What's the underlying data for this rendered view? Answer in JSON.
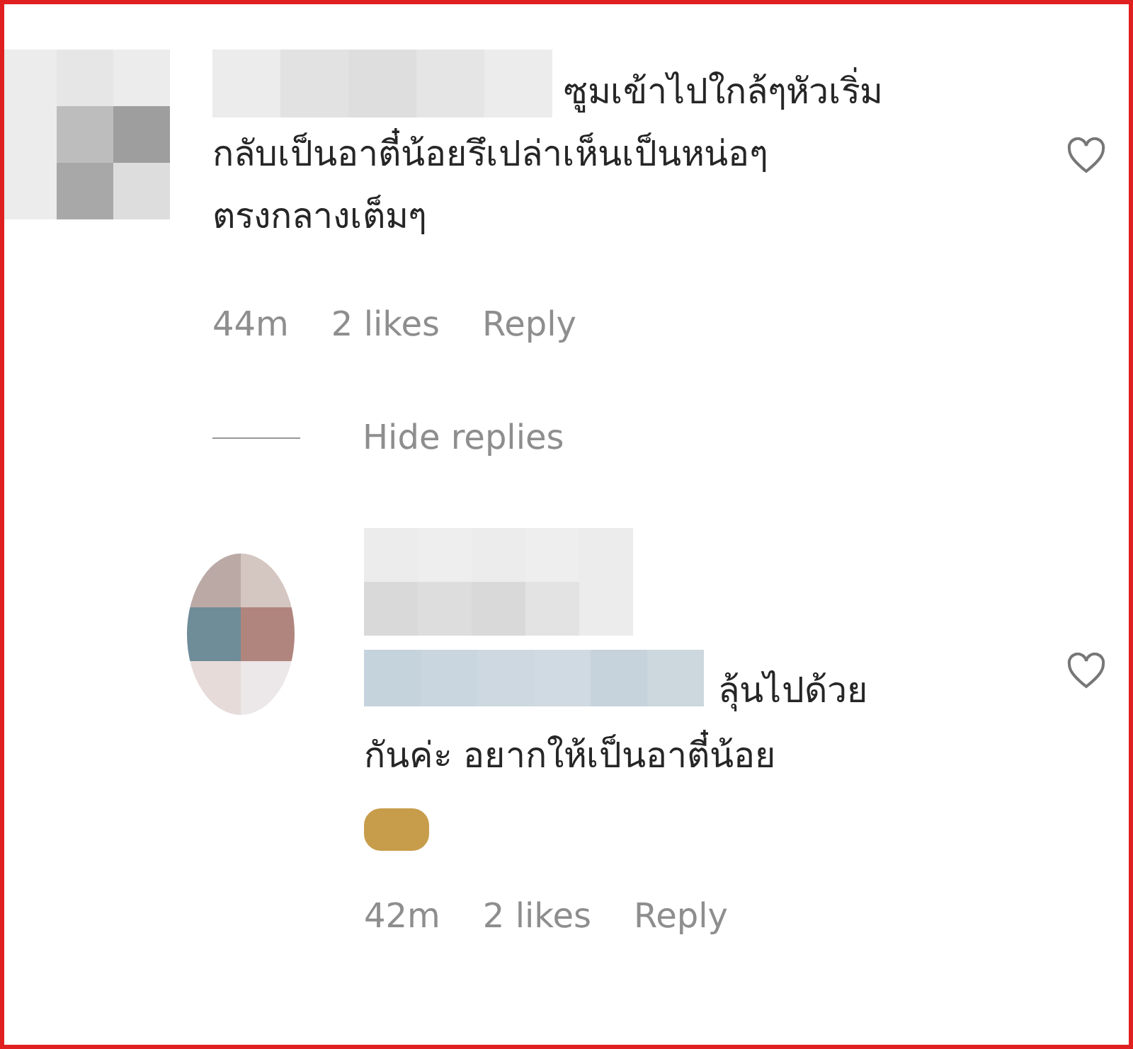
{
  "comments": [
    {
      "text_lines": [
        "ซูมเข้าไปใกล้ๆหัวเริ่ม",
        "กลับเป็นอาตี๋น้อยรึเปล่าเห็นเป็นหน่อๆ",
        "ตรงกลางเต็มๆ"
      ],
      "time": "44m",
      "likes": "2 likes",
      "reply": "Reply",
      "hide_replies": "Hide replies",
      "replies": [
        {
          "text_lines": [
            "ลุ้นไปด้วย",
            "กันค่ะ อยากให้เป็นอาตี๋น้อย"
          ],
          "time": "42m",
          "likes": "2 likes",
          "reply": "Reply"
        }
      ]
    }
  ]
}
